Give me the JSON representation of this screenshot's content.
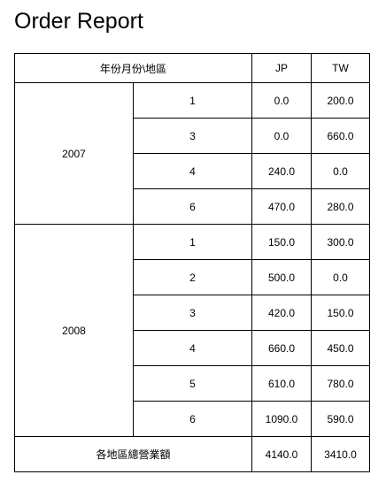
{
  "page": {
    "title": "Order Report"
  },
  "table": {
    "header": {
      "corner_label": "年份月份\\地區",
      "columns": [
        "JP",
        "TW"
      ]
    },
    "groups": [
      {
        "year": "2007",
        "rows": [
          {
            "month": "1",
            "values": [
              "0.0",
              "200.0"
            ]
          },
          {
            "month": "3",
            "values": [
              "0.0",
              "660.0"
            ]
          },
          {
            "month": "4",
            "values": [
              "240.0",
              "0.0"
            ]
          },
          {
            "month": "6",
            "values": [
              "470.0",
              "280.0"
            ]
          }
        ]
      },
      {
        "year": "2008",
        "rows": [
          {
            "month": "1",
            "values": [
              "150.0",
              "300.0"
            ]
          },
          {
            "month": "2",
            "values": [
              "500.0",
              "0.0"
            ]
          },
          {
            "month": "3",
            "values": [
              "420.0",
              "150.0"
            ]
          },
          {
            "month": "4",
            "values": [
              "660.0",
              "450.0"
            ]
          },
          {
            "month": "5",
            "values": [
              "610.0",
              "780.0"
            ]
          },
          {
            "month": "6",
            "values": [
              "1090.0",
              "590.0"
            ]
          }
        ]
      }
    ],
    "total": {
      "label": "各地區總營業額",
      "values": [
        "4140.0",
        "3410.0"
      ]
    }
  }
}
